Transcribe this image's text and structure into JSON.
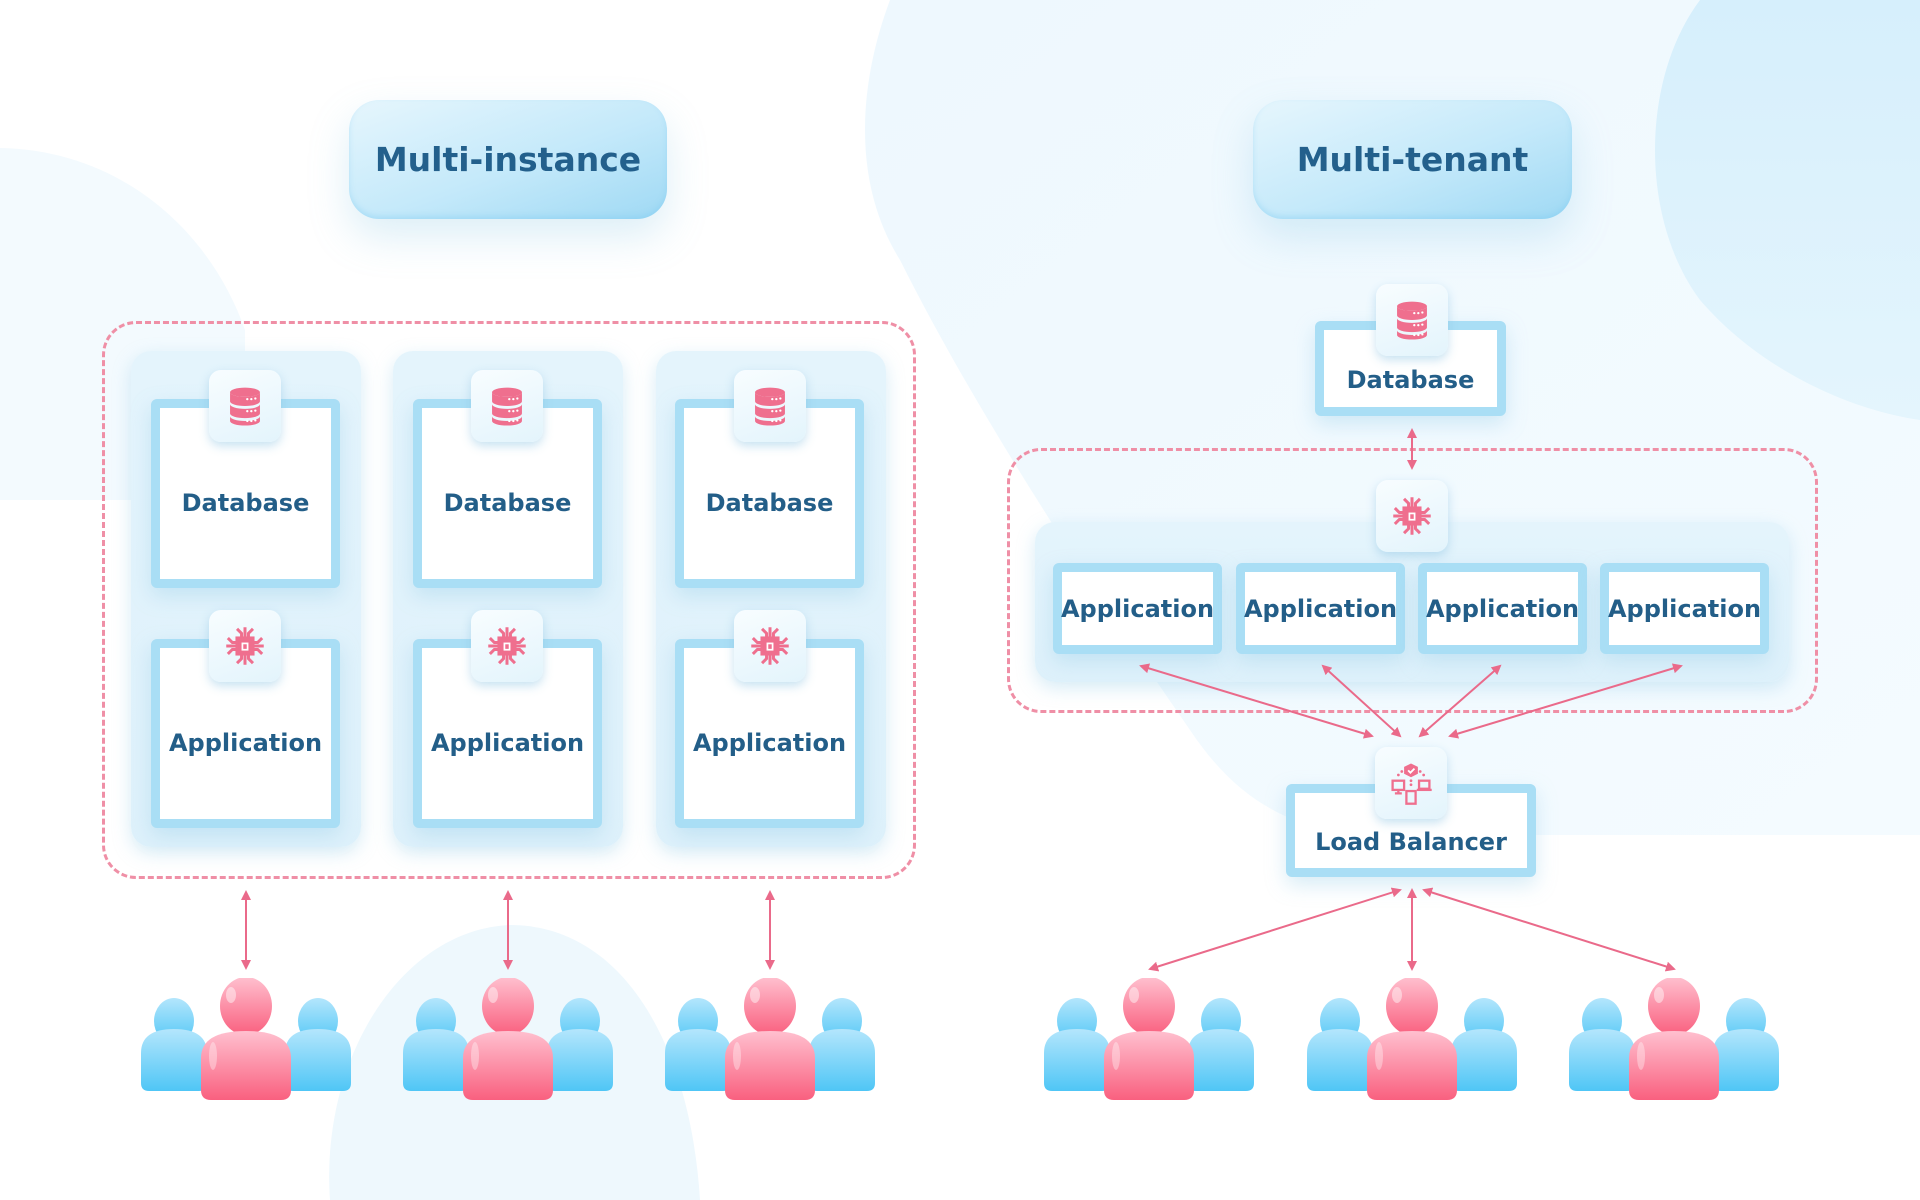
{
  "colors": {
    "accent_pink": "#ef6f8e",
    "accent_blue": "#a9def5",
    "text": "#235e88",
    "dashed": "#ef8fa6"
  },
  "left": {
    "title": "Multi-instance",
    "instances": [
      {
        "database_label": "Database",
        "application_label": "Application",
        "users_icon": "users-group-icon"
      },
      {
        "database_label": "Database",
        "application_label": "Application",
        "users_icon": "users-group-icon"
      },
      {
        "database_label": "Database",
        "application_label": "Application",
        "users_icon": "users-group-icon"
      }
    ]
  },
  "right": {
    "title": "Multi-tenant",
    "database_label": "Database",
    "applications": [
      "Application",
      "Application",
      "Application",
      "Application"
    ],
    "load_balancer_label": "Load Balancer",
    "user_groups": 3
  },
  "icons": {
    "database": "database-icon",
    "application": "cpu-chip-icon",
    "load_balancer": "network-devices-icon",
    "users": "users-group-icon",
    "connector": "double-arrow-icon"
  }
}
